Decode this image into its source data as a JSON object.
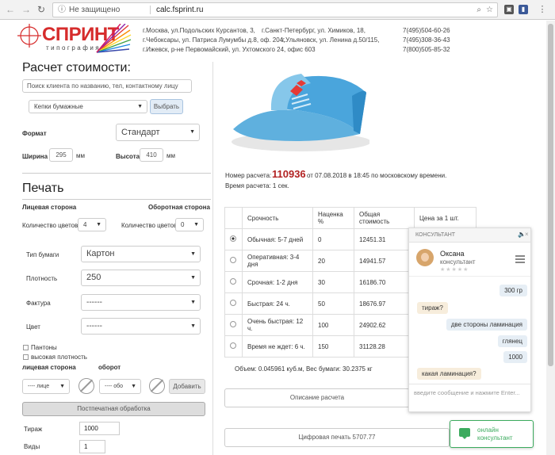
{
  "browser": {
    "secure_label": "Не защищено",
    "url": "calc.fsprint.ru"
  },
  "header": {
    "logo_text": "СПРИНТ",
    "logo_sub": "типография",
    "addresses": [
      [
        "г.Москва, ул.Подольских Курсантов, 3,",
        "г.Санкт-Петербург, ул. Химиков, 18,",
        "7(495)504-60-26"
      ],
      [
        "г.Чебоксары, ул. Патриса Лумумбы д.8, оф. 204,",
        "г.Ульяновск, ул. Ленина д.50/115,",
        "7(495)308-36-43"
      ],
      [
        "г.Ижевск, р-не Первомайский, ул. Ухтомского 24, офис 603",
        "",
        "7(800)505-85-32"
      ]
    ]
  },
  "calc": {
    "title": "Расчет стоимости:",
    "client_placeholder": "Поиск клиента по названию, тел, контактному лицу",
    "product": "Кепки бумажные",
    "select_btn": "Выбрать",
    "format_label": "Формат",
    "format_value": "Стандарт",
    "width_label": "Ширина",
    "width_value": "295",
    "mm": "мм",
    "height_label": "Высота",
    "height_value": "410"
  },
  "print": {
    "title": "Печать",
    "front_label": "Лицевая сторона",
    "back_label": "Оборотная сторона",
    "colors_label": "Количество цветов",
    "front_colors": "4",
    "back_colors": "0",
    "paper_type_label": "Тип бумаги",
    "paper_type": "Картон",
    "density_label": "Плотность",
    "density": "250",
    "texture_label": "Фактура",
    "texture": "------",
    "color_label": "Цвет",
    "color": "------",
    "pantone": "Пантоны",
    "high_density": "высокая плотность",
    "face_side": "лицевая сторона",
    "reverse": "оборот",
    "face_sel": "---- лице",
    "reverse_sel": "---- обо",
    "add_btn": "Добавить",
    "postpress_btn": "Постпечатная обработка",
    "run_label": "Тираж",
    "run_value": "1000",
    "kinds_label": "Виды",
    "kinds_value": "1"
  },
  "order": {
    "number_prefix": "Номер расчета:",
    "number": "110936",
    "number_suffix": "от 07.08.2018 в 18:45 по московскому времени.",
    "calc_time": "Время расчета: 1 сек."
  },
  "table": {
    "headers": [
      "Срочность",
      "Наценка %",
      "Общая стоимость",
      "Цена за 1 шт."
    ],
    "rows": [
      {
        "label": "Обычная: 5-7 дней",
        "markup": "0",
        "total": "12451.31",
        "selected": true
      },
      {
        "label": "Оперативная: 3-4 дня",
        "markup": "20",
        "total": "14941.57",
        "selected": false
      },
      {
        "label": "Срочная: 1-2 дня",
        "markup": "30",
        "total": "16186.70",
        "selected": false
      },
      {
        "label": "Быстрая: 24 ч.",
        "markup": "50",
        "total": "18676.97",
        "selected": false
      },
      {
        "label": "Очень быстрая: 12 ч.",
        "markup": "100",
        "total": "24902.62",
        "selected": false
      },
      {
        "label": "Время не ждет: 6 ч.",
        "markup": "150",
        "total": "31128.28",
        "selected": false
      }
    ]
  },
  "volume": "Объем: 0.045961 куб.м, Вес бумаги: 30.2375 кг",
  "desc_btn": "Описание расчета",
  "digital_btn": "Цифровая печать 5707.77",
  "chat": {
    "header": "КОНСУЛЬТАНТ",
    "name": "Оксана",
    "role": "консультант",
    "messages": [
      {
        "text": "300 гр",
        "side": "me"
      },
      {
        "text": "тираж?",
        "side": "them"
      },
      {
        "text": "две стороны ламинация",
        "side": "me"
      },
      {
        "text": "глянец",
        "side": "me"
      },
      {
        "text": "1000",
        "side": "me"
      },
      {
        "text": "какая ламинация?",
        "side": "them"
      }
    ],
    "input_placeholder": "введите сообщение и нажмите Enter...",
    "online_1": "онлайн",
    "online_2": "консультант"
  },
  "colors": {
    "accent": "#d62c2c",
    "order_number": "#b22222",
    "online_green": "#3cab5e"
  }
}
